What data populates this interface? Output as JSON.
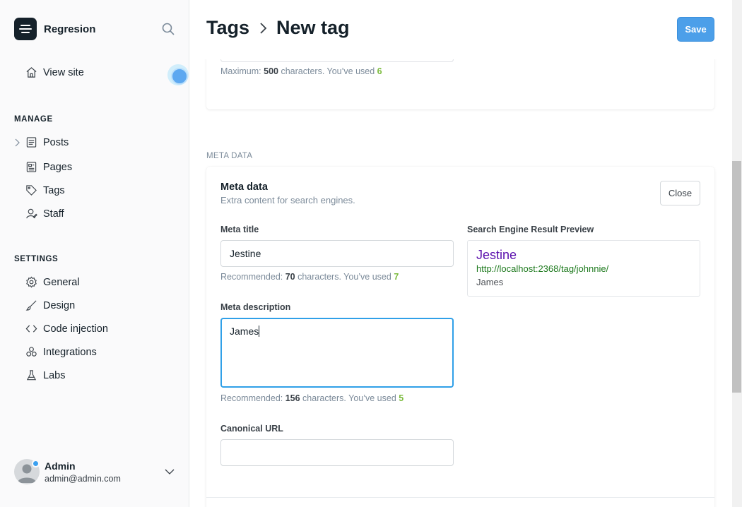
{
  "app": {
    "name": "Regresion"
  },
  "sidebar": {
    "view_site": "View site",
    "manage_heading": "MANAGE",
    "manage_items": [
      {
        "label": "Posts",
        "icon": "posts-icon"
      },
      {
        "label": "Pages",
        "icon": "pages-icon"
      },
      {
        "label": "Tags",
        "icon": "tag-icon"
      },
      {
        "label": "Staff",
        "icon": "staff-icon"
      }
    ],
    "settings_heading": "SETTINGS",
    "settings_items": [
      {
        "label": "General",
        "icon": "gear-icon"
      },
      {
        "label": "Design",
        "icon": "brush-icon"
      },
      {
        "label": "Code injection",
        "icon": "code-icon"
      },
      {
        "label": "Integrations",
        "icon": "integrations-icon"
      },
      {
        "label": "Labs",
        "icon": "flask-icon"
      }
    ],
    "user": {
      "name": "Admin",
      "email": "admin@admin.com"
    }
  },
  "header": {
    "breadcrumb_parent": "Tags",
    "breadcrumb_current": "New tag",
    "save_label": "Save"
  },
  "description_counter": {
    "prefix": "Maximum: ",
    "max": "500",
    "middle": " characters. You’ve used ",
    "used": "6"
  },
  "meta_section": {
    "section_label": "META DATA",
    "title": "Meta data",
    "subtitle": "Extra content for search engines.",
    "close_label": "Close",
    "meta_title_label": "Meta title",
    "meta_title_value": "Jestine",
    "meta_title_counter": {
      "prefix": "Recommended: ",
      "max": "70",
      "middle": " characters. You’ve used ",
      "used": "7"
    },
    "meta_description_label": "Meta description",
    "meta_description_value": "James",
    "meta_description_counter": {
      "prefix": "Recommended: ",
      "max": "156",
      "middle": " characters. You’ve used ",
      "used": "5"
    },
    "canonical_label": "Canonical URL",
    "canonical_value": "",
    "preview_label": "Search Engine Result Preview",
    "preview": {
      "title": "Jestine",
      "url": "http://localhost:2368/tag/johnnie/",
      "description": "James"
    }
  },
  "colors": {
    "accent": "#4c9fe9",
    "counter_green": "#7cbb3e",
    "serp_title": "#5a0fad",
    "serp_url": "#1e7a1e"
  }
}
